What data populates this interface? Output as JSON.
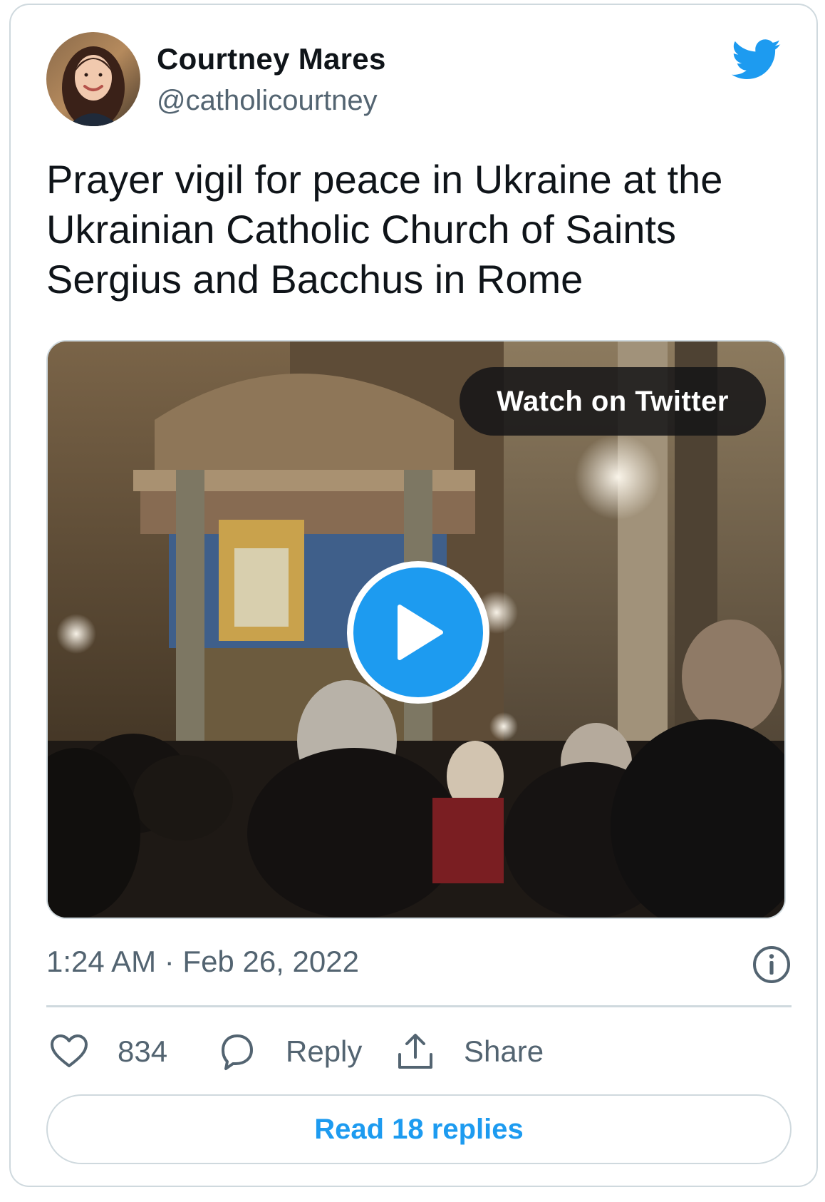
{
  "author": {
    "display_name": "Courtney Mares",
    "handle": "@catholicourtney",
    "avatar_icon": "person-avatar"
  },
  "brand_icon": "twitter-bird-icon",
  "brand_color": "#1d9bf0",
  "tweet": {
    "text": "Prayer vigil for peace in Ukraine at the Ukrainian Catholic Church of Saints Sergius and Bacchus in Rome"
  },
  "media": {
    "type": "video",
    "watch_label": "Watch on Twitter",
    "play_icon": "play-icon"
  },
  "meta": {
    "timestamp": "1:24 AM · Feb 26, 2022",
    "info_icon": "info-icon"
  },
  "actions": {
    "like_count": "834",
    "reply_label": "Reply",
    "share_label": "Share"
  },
  "read_replies_label": "Read 18 replies"
}
